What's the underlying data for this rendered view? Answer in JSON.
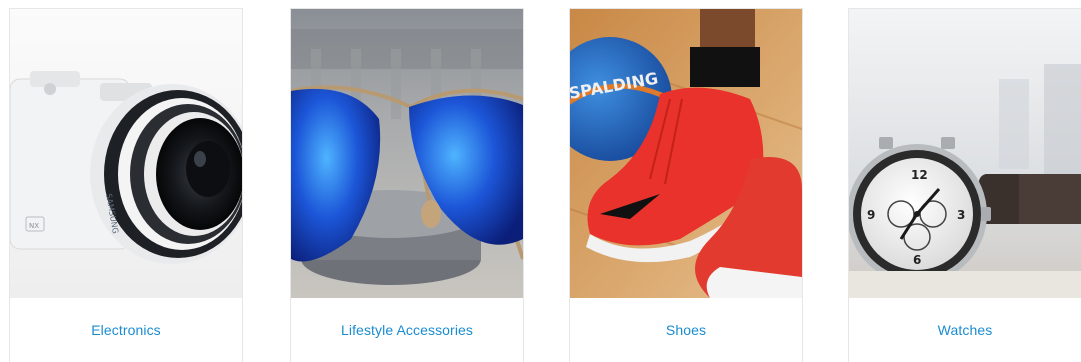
{
  "categories": [
    {
      "label": "Electronics",
      "image": "camera-photo"
    },
    {
      "label": "Lifestyle Accessories",
      "image": "sunglasses-photo"
    },
    {
      "label": "Shoes",
      "image": "sneakers-photo"
    },
    {
      "label": "Watches",
      "image": "watch-photo"
    }
  ],
  "colors": {
    "link": "#1a8cd0",
    "card_border": "#e6e6e6"
  }
}
